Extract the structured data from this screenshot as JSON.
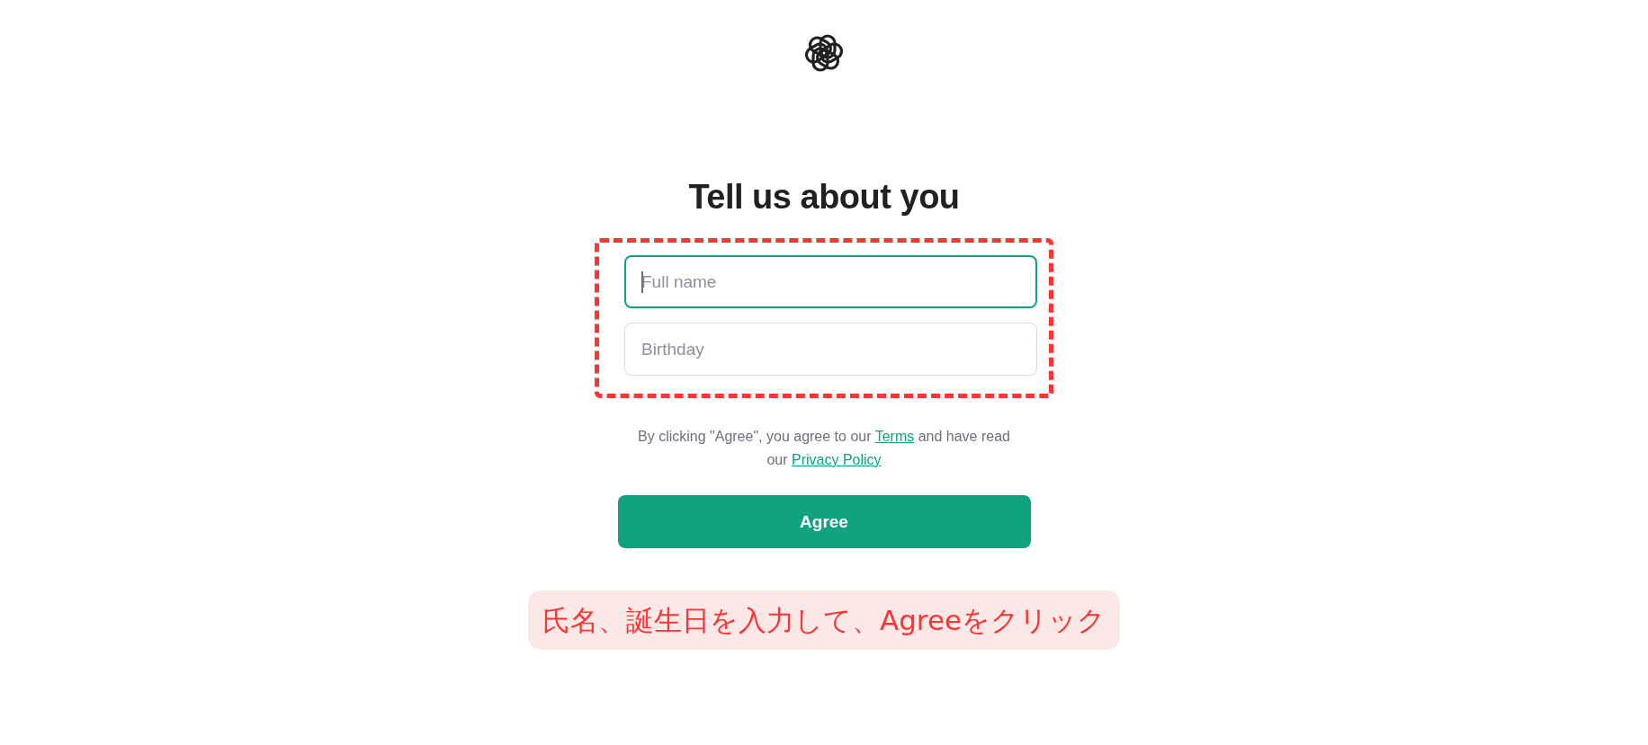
{
  "heading": "Tell us about you",
  "fields": [
    {
      "placeholder": "Full name",
      "focused": true
    },
    {
      "placeholder": "Birthday",
      "focused": false
    }
  ],
  "consent": {
    "before": "By clicking \"Agree\", you agree to our ",
    "terms_link": "Terms",
    "middle": " and have read our ",
    "privacy_link": "Privacy Policy"
  },
  "button": "Agree",
  "annotation": "氏名、誕生日を入力して、Agreeをクリック"
}
